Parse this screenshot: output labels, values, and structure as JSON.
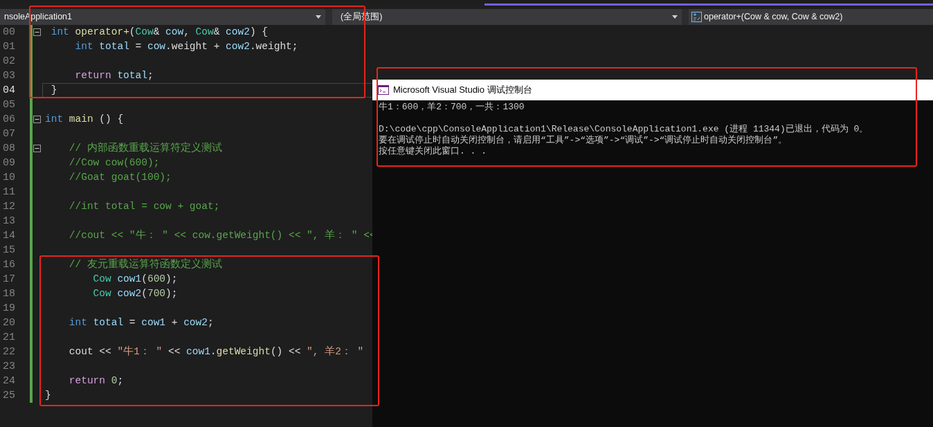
{
  "navigation_bar": {
    "project": "nsoleApplication1",
    "scope": "(全局范围)",
    "member": "operator+(Cow & cow, Cow & cow2)"
  },
  "editor": {
    "lines": [
      {
        "number": "00",
        "current": false,
        "fold": true,
        "tokens": [
          {
            "text": " int ",
            "kind": "keyword"
          },
          {
            "text": "operator+",
            "kind": "function"
          },
          {
            "text": "(",
            "kind": "plain"
          },
          {
            "text": "Cow",
            "kind": "type"
          },
          {
            "text": "& ",
            "kind": "plain"
          },
          {
            "text": "cow",
            "kind": "variable"
          },
          {
            "text": ", ",
            "kind": "plain"
          },
          {
            "text": "Cow",
            "kind": "type"
          },
          {
            "text": "& ",
            "kind": "plain"
          },
          {
            "text": "cow2",
            "kind": "variable"
          },
          {
            "text": ") {",
            "kind": "plain"
          }
        ]
      },
      {
        "number": "01",
        "current": false,
        "fold": false,
        "tokens": [
          {
            "text": "     int ",
            "kind": "keyword"
          },
          {
            "text": "total",
            "kind": "variable"
          },
          {
            "text": " = ",
            "kind": "plain"
          },
          {
            "text": "cow",
            "kind": "variable"
          },
          {
            "text": ".weight + ",
            "kind": "plain"
          },
          {
            "text": "cow2",
            "kind": "variable"
          },
          {
            "text": ".weight;",
            "kind": "plain"
          }
        ]
      },
      {
        "number": "02",
        "current": false,
        "fold": false
      },
      {
        "number": "03",
        "current": false,
        "fold": false,
        "tokens": [
          {
            "text": "     return ",
            "kind": "control"
          },
          {
            "text": "total",
            "kind": "variable"
          },
          {
            "text": ";",
            "kind": "plain"
          }
        ]
      },
      {
        "number": "04",
        "current": true,
        "fold": false,
        "tokens": [
          {
            "text": " }",
            "kind": "plain"
          }
        ]
      },
      {
        "number": "05",
        "current": false,
        "fold": false
      },
      {
        "number": "06",
        "current": false,
        "fold": true,
        "tokens": [
          {
            "text": "int ",
            "kind": "keyword"
          },
          {
            "text": "main",
            "kind": "function"
          },
          {
            "text": " () {",
            "kind": "plain"
          }
        ]
      },
      {
        "number": "07",
        "current": false,
        "fold": false
      },
      {
        "number": "08",
        "current": false,
        "fold": true,
        "tokens": [
          {
            "text": "    // 内部函数重载运算符定义测试",
            "kind": "comment"
          }
        ]
      },
      {
        "number": "09",
        "current": false,
        "fold": false,
        "tokens": [
          {
            "text": "    //Cow cow(600);",
            "kind": "comment"
          }
        ]
      },
      {
        "number": "10",
        "current": false,
        "fold": false,
        "tokens": [
          {
            "text": "    //Goat goat(100);",
            "kind": "comment"
          }
        ]
      },
      {
        "number": "11",
        "current": false,
        "fold": false
      },
      {
        "number": "12",
        "current": false,
        "fold": false,
        "tokens": [
          {
            "text": "    //int total = cow + goat;",
            "kind": "comment"
          }
        ]
      },
      {
        "number": "13",
        "current": false,
        "fold": false
      },
      {
        "number": "14",
        "current": false,
        "fold": false,
        "tokens": [
          {
            "text": "    //cout << \"牛： \" << cow.getWeight() << \", 羊： \" <<",
            "kind": "comment"
          }
        ]
      },
      {
        "number": "15",
        "current": false,
        "fold": false
      },
      {
        "number": "16",
        "current": false,
        "fold": false,
        "tokens": [
          {
            "text": "    // 友元重载运算符函数定义测试",
            "kind": "comment"
          }
        ]
      },
      {
        "number": "17",
        "current": false,
        "fold": false,
        "tokens": [
          {
            "text": "        Cow ",
            "kind": "type"
          },
          {
            "text": "cow1",
            "kind": "variable"
          },
          {
            "text": "(",
            "kind": "plain"
          },
          {
            "text": "600",
            "kind": "number"
          },
          {
            "text": ");",
            "kind": "plain"
          }
        ]
      },
      {
        "number": "18",
        "current": false,
        "fold": false,
        "tokens": [
          {
            "text": "        Cow ",
            "kind": "type"
          },
          {
            "text": "cow2",
            "kind": "variable"
          },
          {
            "text": "(",
            "kind": "plain"
          },
          {
            "text": "700",
            "kind": "number"
          },
          {
            "text": ");",
            "kind": "plain"
          }
        ]
      },
      {
        "number": "19",
        "current": false,
        "fold": false
      },
      {
        "number": "20",
        "current": false,
        "fold": false,
        "tokens": [
          {
            "text": "    int ",
            "kind": "keyword"
          },
          {
            "text": "total",
            "kind": "variable"
          },
          {
            "text": " = ",
            "kind": "plain"
          },
          {
            "text": "cow1",
            "kind": "variable"
          },
          {
            "text": " + ",
            "kind": "plain"
          },
          {
            "text": "cow2",
            "kind": "variable"
          },
          {
            "text": ";",
            "kind": "plain"
          }
        ]
      },
      {
        "number": "21",
        "current": false,
        "fold": false
      },
      {
        "number": "22",
        "current": false,
        "fold": false,
        "tokens": [
          {
            "text": "    cout << ",
            "kind": "plain"
          },
          {
            "text": "\"牛1： \"",
            "kind": "string"
          },
          {
            "text": " << ",
            "kind": "plain"
          },
          {
            "text": "cow1",
            "kind": "variable"
          },
          {
            "text": ".",
            "kind": "plain"
          },
          {
            "text": "getWeight",
            "kind": "function"
          },
          {
            "text": "() << ",
            "kind": "plain"
          },
          {
            "text": "\", 羊2： \"",
            "kind": "string"
          }
        ]
      },
      {
        "number": "23",
        "current": false,
        "fold": false
      },
      {
        "number": "24",
        "current": false,
        "fold": false,
        "tokens": [
          {
            "text": "    return ",
            "kind": "control"
          },
          {
            "text": "0",
            "kind": "number"
          },
          {
            "text": ";",
            "kind": "plain"
          }
        ]
      },
      {
        "number": "25",
        "current": false,
        "fold": false,
        "tokens": [
          {
            "text": "}",
            "kind": "plain"
          }
        ]
      }
    ]
  },
  "console_window": {
    "title": "Microsoft Visual Studio 调试控制台",
    "output": [
      [
        "牛1：600，羊2：700，一共：1300"
      ],
      [
        "D:\\code\\cpp\\ConsoleApplication1\\Release\\ConsoleApplication1.exe (进程 11344)已退出，代码为 0。",
        "要在调试停止时自动关闭控制台，请启用“工具”->“选项”->“调试”->“调试停止时自动关闭控制台”。",
        "按任意键关闭此窗口. . ."
      ]
    ]
  }
}
